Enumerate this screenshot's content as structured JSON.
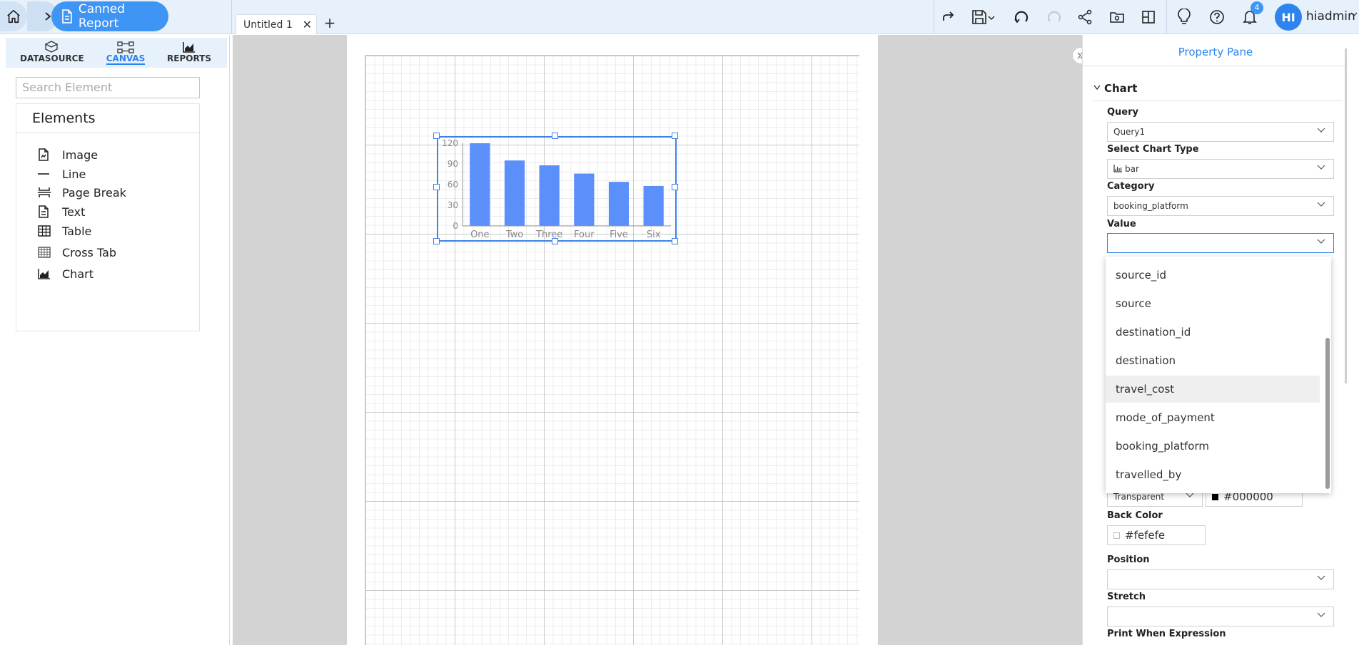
{
  "topbar": {
    "breadcrumb_active": "Canned Report",
    "tab_title": "Untitled 1",
    "tab_close": "✕",
    "tab_add": "+",
    "notification_count": "4",
    "avatar_initials": "HI",
    "username": "hiadmin"
  },
  "left_panel": {
    "tabs": [
      {
        "label": "DATASOURCE",
        "icon": "datasource-icon"
      },
      {
        "label": "CANVAS",
        "icon": "canvas-icon",
        "active": true
      },
      {
        "label": "REPORTS",
        "icon": "reports-icon"
      }
    ],
    "search_placeholder": "Search Element",
    "elements_title": "Elements",
    "elements": [
      {
        "label": "Image",
        "icon": "image-icon"
      },
      {
        "label": "Line",
        "icon": "line-icon"
      },
      {
        "label": "Page Break",
        "icon": "page-break-icon"
      },
      {
        "label": "Text",
        "icon": "text-icon"
      },
      {
        "label": "Table",
        "icon": "table-icon"
      },
      {
        "label": "Cross Tab",
        "icon": "cross-tab-icon"
      },
      {
        "label": "Chart",
        "icon": "chart-icon"
      }
    ]
  },
  "chart_data": {
    "type": "bar",
    "categories": [
      "One",
      "Two",
      "Three",
      "Four",
      "Five",
      "Six"
    ],
    "values": [
      120,
      95,
      88,
      76,
      64,
      58
    ],
    "yticks": [
      "0",
      "30",
      "60",
      "90",
      "120"
    ],
    "ylim": [
      0,
      120
    ],
    "bar_color": "#5b8ff9",
    "title": "",
    "xlabel": "",
    "ylabel": ""
  },
  "property_pane": {
    "title": "Property Pane",
    "section": "Chart",
    "query_label": "Query",
    "query_value": "Query1",
    "chart_type_label": "Select Chart Type",
    "chart_type_value": "bar",
    "category_label": "Category",
    "category_value": "booking_platform",
    "value_label": "Value",
    "value_value": "",
    "dropdown_options": [
      "source_id",
      "source",
      "destination_id",
      "destination",
      "travel_cost",
      "mode_of_payment",
      "booking_platform",
      "travelled_by"
    ],
    "dropdown_highlighted": "travel_cost",
    "mode_value": "Transparent",
    "fore_color_value": "#000000",
    "back_color_label": "Back Color",
    "back_color_value": "#fefefe",
    "position_label": "Position",
    "stretch_label": "Stretch",
    "print_when_label": "Print When Expression"
  },
  "colors": {
    "accent": "#2d84ee",
    "breadcrumb_active_bg": "#3f95f4",
    "topbar_bg": "#e6f1fb",
    "canvas_bg": "#d3d3d3"
  }
}
